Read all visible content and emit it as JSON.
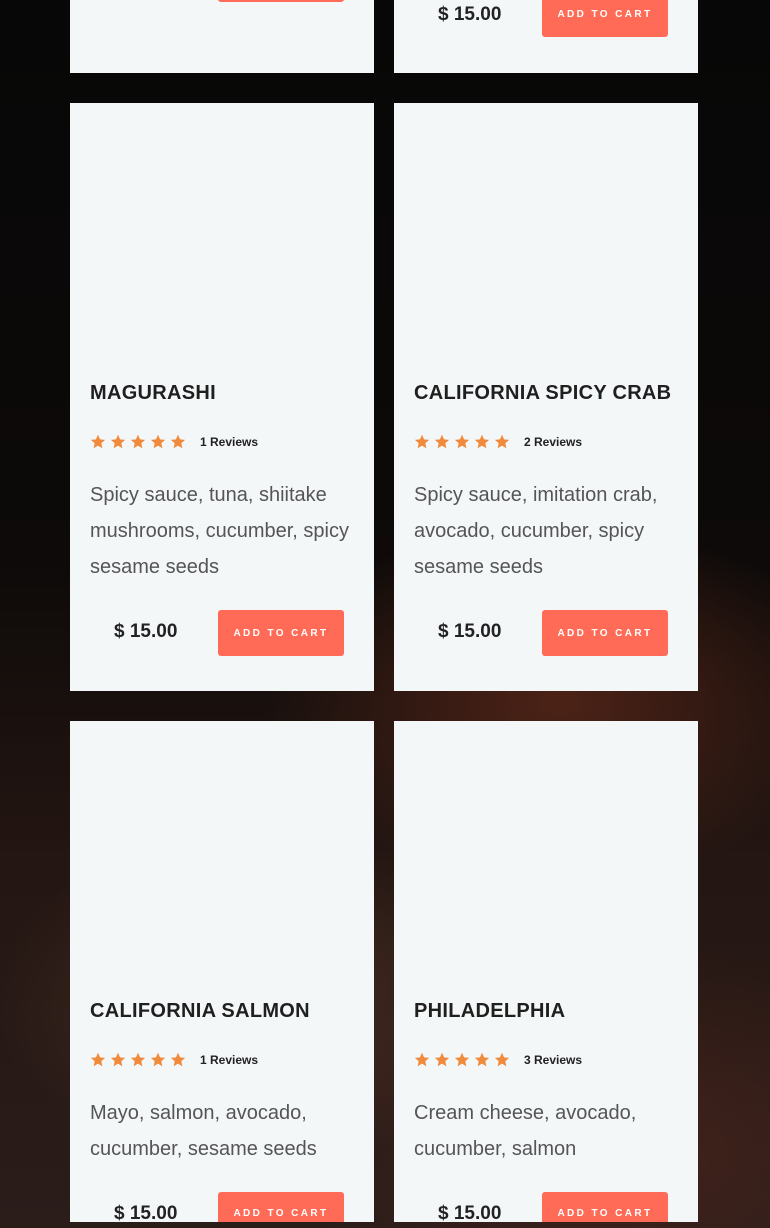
{
  "top_row": {
    "right_price": "$ 15.00",
    "right_cart_label": "ADD TO CART"
  },
  "products": [
    {
      "name": "MAGURASHI",
      "rating": 5,
      "reviews": "1 Reviews",
      "description": "Spicy sauce, tuna, shiitake mushrooms, cucumber, spicy sesame seeds",
      "price": "$ 15.00",
      "cart_label": "ADD TO CART"
    },
    {
      "name": "CALIFORNIA SPICY CRAB",
      "rating": 5,
      "reviews": "2 Reviews",
      "description": "Spicy sauce, imitation crab, avocado, cucumber, spicy sesame seeds",
      "price": "$ 15.00",
      "cart_label": "ADD TO CART"
    },
    {
      "name": "CALIFORNIA SALMON",
      "rating": 5,
      "reviews": "1 Reviews",
      "description": "Mayo, salmon, avocado, cucumber, sesame seeds",
      "price": "$ 15.00",
      "cart_label": "ADD TO CART"
    },
    {
      "name": "PHILADELPHIA",
      "rating": 5,
      "reviews": "3 Reviews",
      "description": "Cream cheese, avocado, cucumber, salmon",
      "price": "$ 15.00",
      "cart_label": "ADD TO CART"
    }
  ],
  "colors": {
    "accent": "#ff6b57",
    "star": "#f08a3c",
    "card_bg": "#f4f7f8"
  },
  "icons": {
    "rating_star": "star-icon"
  }
}
